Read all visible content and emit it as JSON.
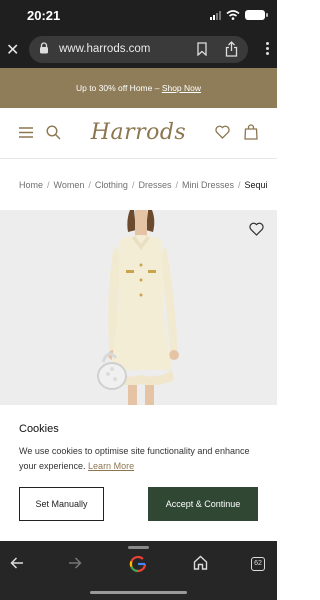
{
  "status_bar": {
    "time": "20:21"
  },
  "browser": {
    "url": "www.harrods.com"
  },
  "promo": {
    "text": "Up to 30% off Home – ",
    "link": "Shop Now"
  },
  "header": {
    "logo": "Harrods"
  },
  "breadcrumb": {
    "items": [
      "Home",
      "Women",
      "Clothing",
      "Dresses",
      "Mini Dresses"
    ],
    "current": "Sequi"
  },
  "cookies": {
    "title": "Cookies",
    "text": "We use cookies to optimise site functionality and enhance your experience. ",
    "learn_more": "Learn More",
    "set_manually": "Set Manually",
    "accept": "Accept & Continue"
  },
  "toolbar": {
    "tab_count": "62"
  },
  "colors": {
    "brand": "#8c7650",
    "promo_bg": "#8f7d59",
    "accept_bg": "#2f4733"
  }
}
